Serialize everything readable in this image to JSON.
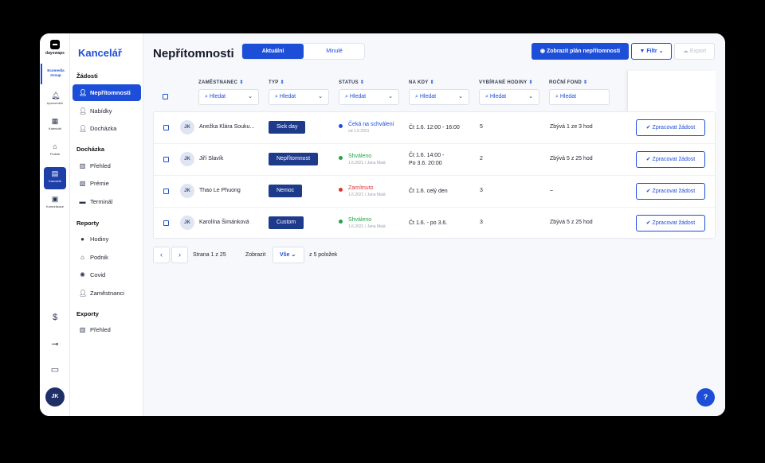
{
  "brand": {
    "name": "dayswaps",
    "org": "Ecomedia Group"
  },
  "rail": [
    {
      "label": "Upozornění",
      "icon": "bell-icon"
    },
    {
      "label": "Kalendář",
      "icon": "calendar-icon"
    },
    {
      "label": "Podnik",
      "icon": "home-icon"
    },
    {
      "label": "Kancelář",
      "icon": "office-icon"
    },
    {
      "label": "Komunikace",
      "icon": "chat-icon"
    }
  ],
  "rail_bottom": [
    {
      "icon": "dollar-icon",
      "glyph": "$"
    },
    {
      "icon": "plug-icon",
      "glyph": "⊸"
    },
    {
      "icon": "video-icon",
      "glyph": "▭"
    }
  ],
  "user": {
    "initials": "JK"
  },
  "sidebar": {
    "title": "Kancelář",
    "sections": [
      {
        "title": "Žádosti",
        "items": [
          {
            "label": "Nepřítomnosti",
            "icon": "user-icon"
          },
          {
            "label": "Nabídky",
            "icon": "user-icon"
          },
          {
            "label": "Docházka",
            "icon": "user-icon"
          }
        ]
      },
      {
        "title": "Docházka",
        "items": [
          {
            "label": "Přehled",
            "icon": "building-icon"
          },
          {
            "label": "Prémie",
            "icon": "badge-icon"
          },
          {
            "label": "Terminál",
            "icon": "terminal-icon"
          }
        ]
      },
      {
        "title": "Reporty",
        "items": [
          {
            "label": "Hodiny",
            "icon": "clock-icon"
          },
          {
            "label": "Podnik",
            "icon": "home-icon"
          },
          {
            "label": "Covid",
            "icon": "virus-icon"
          },
          {
            "label": "Zaměstnanci",
            "icon": "user-icon"
          }
        ]
      },
      {
        "title": "Exporty",
        "items": [
          {
            "label": "Přehled",
            "icon": "building-icon"
          }
        ]
      }
    ]
  },
  "header": {
    "title": "Nepřítomnosti",
    "tabs": [
      {
        "label": "Aktuální"
      },
      {
        "label": "Minulé"
      }
    ],
    "plan_button": "Zobrazit plán nepřítomnosti",
    "filter_button": "Filtr",
    "export_button": "Export"
  },
  "table": {
    "columns": [
      "ZAMĚSTNANEC",
      "TYP",
      "STATUS",
      "NA KDY",
      "VYBÍRANÉ HODINY",
      "ROČNÍ FOND"
    ],
    "search_placeholder": "Hledat",
    "rows": [
      {
        "initials": "JK",
        "name": "Anežka Klára Souku...",
        "type": "Sick day",
        "status": "Čeká na schválení",
        "status_sub": "od 1.6.2021",
        "status_color": "#1d4ed8",
        "when": [
          "Čt 1.6. 12:00 - 16:00"
        ],
        "hours": "5",
        "fund": "Zbývá 1 ze 3 hod",
        "action": "Zpracovat žádost"
      },
      {
        "initials": "JK",
        "name": "Jiří Slavík",
        "type": "Nepřítomnost",
        "status": "Shváleno",
        "status_sub": "1.6.2021 / Jana Malá",
        "status_color": "#22a34a",
        "when": [
          "Čt 1.6. 14:00 -",
          "Po 3.6. 20:00"
        ],
        "hours": "2",
        "fund": "Zbývá 5 z 25 hod",
        "action": "Zpracovat žádost"
      },
      {
        "initials": "JK",
        "name": "Thao Le Phuong",
        "type": "Nemoc",
        "status": "Zamítnuto",
        "status_sub": "1.6.2021 / Jana Malá",
        "status_color": "#e03131",
        "when": [
          "Čt 1.6. celý den"
        ],
        "hours": "3",
        "fund": "–",
        "action": "Zpracovat žádost"
      },
      {
        "initials": "JK",
        "name": "Karolína Šimánková",
        "type": "Custom",
        "status": "Shváleno",
        "status_sub": "1.6.2021 / Jana Malá",
        "status_color": "#22a34a",
        "when": [
          "Čt 1.6. - po 3.6."
        ],
        "hours": "3",
        "fund": "Zbývá 5 z 25 hod",
        "action": "Zpracovat žádost"
      }
    ]
  },
  "pagination": {
    "page_text": "Strana 1 z 25",
    "show_label": "Zobrazit",
    "show_value": "Vše",
    "of_text": "z 5 položek"
  },
  "help": {
    "label": "?"
  }
}
